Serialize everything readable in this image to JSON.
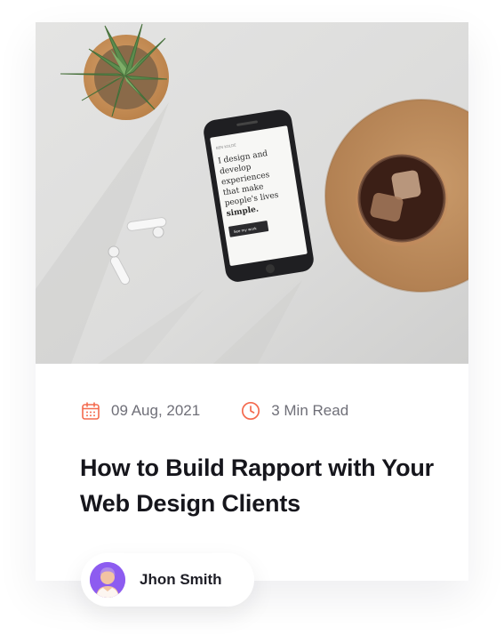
{
  "post": {
    "date": "09 Aug, 2021",
    "read_time": "3 Min Read",
    "title": "How to Build Rapport with Your Web Design Clients",
    "image_icon": "desk-photo",
    "phone_screen": {
      "brand": "BEN KOLDE",
      "headline": "I design and develop experiences that make people's lives",
      "emphasis": "simple.",
      "button": "See my work"
    }
  },
  "author": {
    "name": "Jhon Smith",
    "avatar_icon": "user-avatar"
  },
  "icons": {
    "date": "calendar-icon",
    "read_time": "clock-icon"
  },
  "colors": {
    "accent": "#f46a4e",
    "title": "#16161c",
    "meta_text": "#6f6f78",
    "avatar_bg": "#8d5cf0"
  }
}
